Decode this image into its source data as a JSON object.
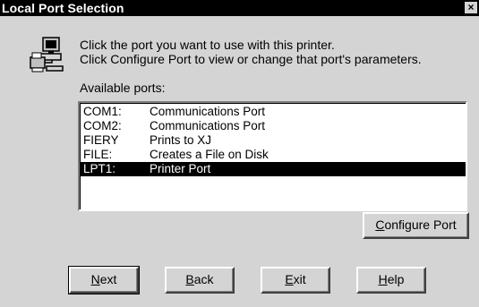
{
  "window": {
    "title": "Local Port Selection",
    "close_glyph": "×"
  },
  "instructions": {
    "line1": "Click the port you want to use with this printer.",
    "line2": "Click Configure Port to view or change that port's parameters."
  },
  "available_label": "Available ports:",
  "ports": [
    {
      "name": "COM1:",
      "description": "Communications Port",
      "selected": false
    },
    {
      "name": "COM2:",
      "description": "Communications Port",
      "selected": false
    },
    {
      "name": "FIERY",
      "description": "Prints to XJ",
      "selected": false
    },
    {
      "name": "FILE:",
      "description": "Creates a File on Disk",
      "selected": false
    },
    {
      "name": "LPT1:",
      "description": "Printer Port",
      "selected": true
    }
  ],
  "buttons": {
    "configure": {
      "mnemonic": "C",
      "rest": "onfigure Port"
    },
    "next": {
      "mnemonic": "N",
      "rest": "ext"
    },
    "back": {
      "mnemonic": "B",
      "rest": "ack"
    },
    "exit": {
      "mnemonic": "E",
      "rest": "xit"
    },
    "help": {
      "mnemonic": "H",
      "rest": "elp"
    }
  },
  "icons": {
    "printer": "printer-computer-icon"
  }
}
